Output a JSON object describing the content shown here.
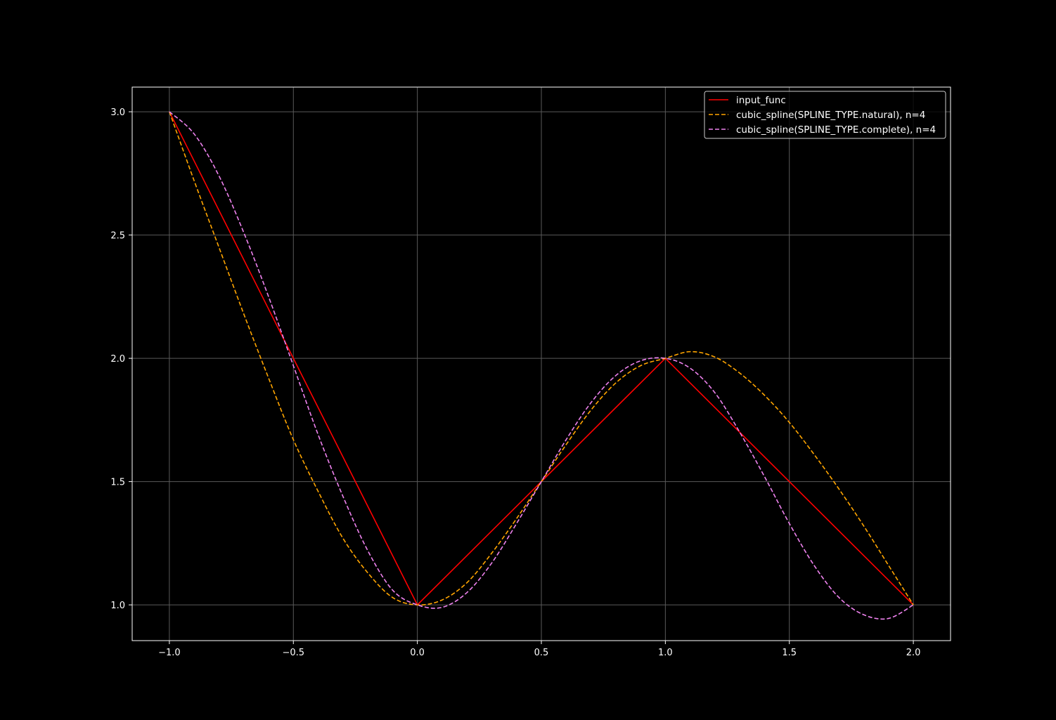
{
  "chart_data": {
    "type": "line",
    "title": "",
    "xlabel": "",
    "ylabel": "",
    "xlim": [
      -1.15,
      2.15
    ],
    "ylim": [
      0.855,
      3.1
    ],
    "x_ticks": [
      -1.0,
      -0.5,
      0.0,
      0.5,
      1.0,
      1.5,
      2.0
    ],
    "x_tick_labels": [
      "−1.0",
      "−0.5",
      "0.0",
      "0.5",
      "1.0",
      "1.5",
      "2.0"
    ],
    "y_ticks": [
      1.0,
      1.5,
      2.0,
      2.5,
      3.0
    ],
    "y_tick_labels": [
      "1.0",
      "1.5",
      "2.0",
      "2.5",
      "3.0"
    ],
    "grid": true,
    "legend_position": "top-right",
    "background_color": "#000000",
    "foreground_color": "#ffffff",
    "grid_color": "#5a5a5a",
    "series": [
      {
        "name": "input_func",
        "color": "#ff0000",
        "style": "solid",
        "x": [
          -1.0,
          0.0,
          1.0,
          2.0
        ],
        "y": [
          3.0,
          1.0,
          2.0,
          1.0
        ]
      },
      {
        "name": "cubic_spline(SPLINE_TYPE.natural), n=4",
        "color": "#ffa500",
        "style": "dashed",
        "x": [
          -1.0,
          -0.9,
          -0.8,
          -0.7,
          -0.6,
          -0.5,
          -0.4,
          -0.3,
          -0.2,
          -0.1,
          0.0,
          0.1,
          0.2,
          0.3,
          0.4,
          0.5,
          0.6,
          0.7,
          0.8,
          0.9,
          1.0,
          1.1,
          1.2,
          1.3,
          1.4,
          1.5,
          1.6,
          1.7,
          1.8,
          1.9,
          2.0
        ],
        "y": [
          3.0,
          2.72,
          2.45,
          2.18,
          1.92,
          1.67,
          1.46,
          1.27,
          1.13,
          1.03,
          1.0,
          1.02,
          1.09,
          1.21,
          1.35,
          1.5,
          1.65,
          1.79,
          1.9,
          1.97,
          2.0,
          2.027,
          2.005,
          1.94,
          1.85,
          1.74,
          1.61,
          1.47,
          1.32,
          1.16,
          1.0
        ]
      },
      {
        "name": "cubic_spline(SPLINE_TYPE.complete), n=4",
        "color": "#ee82ee",
        "style": "dashed",
        "x": [
          -1.0,
          -0.9,
          -0.8,
          -0.7,
          -0.6,
          -0.5,
          -0.4,
          -0.3,
          -0.2,
          -0.1,
          0.0,
          0.1,
          0.2,
          0.3,
          0.4,
          0.5,
          0.6,
          0.7,
          0.8,
          0.9,
          1.0,
          1.1,
          1.2,
          1.3,
          1.4,
          1.5,
          1.6,
          1.7,
          1.8,
          1.9,
          2.0
        ],
        "y": [
          3.0,
          2.91,
          2.74,
          2.51,
          2.25,
          1.97,
          1.69,
          1.44,
          1.22,
          1.06,
          1.0,
          0.99,
          1.05,
          1.17,
          1.33,
          1.5,
          1.67,
          1.82,
          1.93,
          1.99,
          2.0,
          1.96,
          1.86,
          1.7,
          1.52,
          1.33,
          1.16,
          1.03,
          0.96,
          0.945,
          1.0
        ]
      }
    ]
  }
}
